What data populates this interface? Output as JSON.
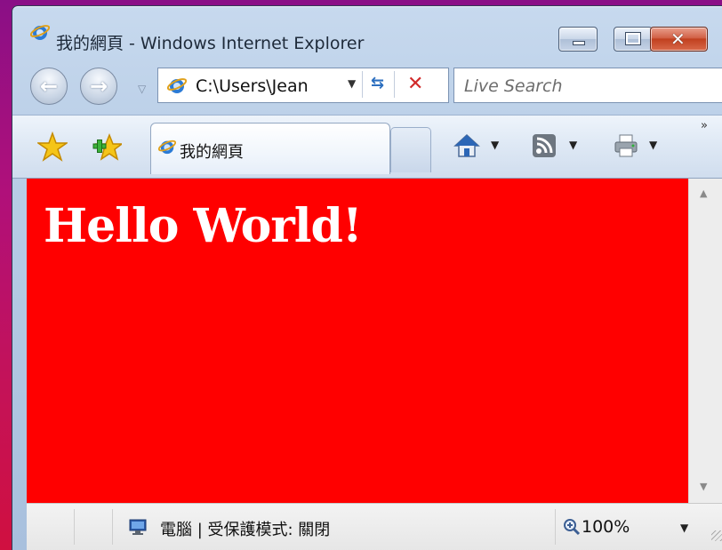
{
  "window": {
    "title": "我的網頁 - Windows Internet Explorer",
    "close_glyph": "✕"
  },
  "navigation": {
    "back_glyph": "←",
    "forward_glyph": "→",
    "dropdown_glyph": "▽",
    "address": "C:\\Users\\Jean",
    "address_dropdown_glyph": "▼",
    "refresh_glyph": "⇆",
    "stop_glyph": "✕",
    "search_placeholder": "Live Search"
  },
  "tabs": {
    "active_tab_title": "我的網頁",
    "chevron_more": "»",
    "dropdown_glyph": "▼"
  },
  "content": {
    "heading": "Hello World!",
    "background_color": "#ff0000",
    "heading_color": "#ffffff"
  },
  "scrollbar": {
    "up_glyph": "▲",
    "down_glyph": "▼"
  },
  "status": {
    "zone_text": "電腦 | 受保護模式: 關閉",
    "zoom": "100%",
    "zoom_dropdown_glyph": "▼"
  },
  "icons": {
    "app": "ie-logo-icon",
    "favorites": "favorites-star-icon",
    "add_favorites": "add-favorites-icon",
    "home": "home-icon",
    "feeds": "rss-feed-icon",
    "print": "printer-icon",
    "zone": "computer-zone-icon",
    "zoom": "zoom-magnifier-icon"
  }
}
